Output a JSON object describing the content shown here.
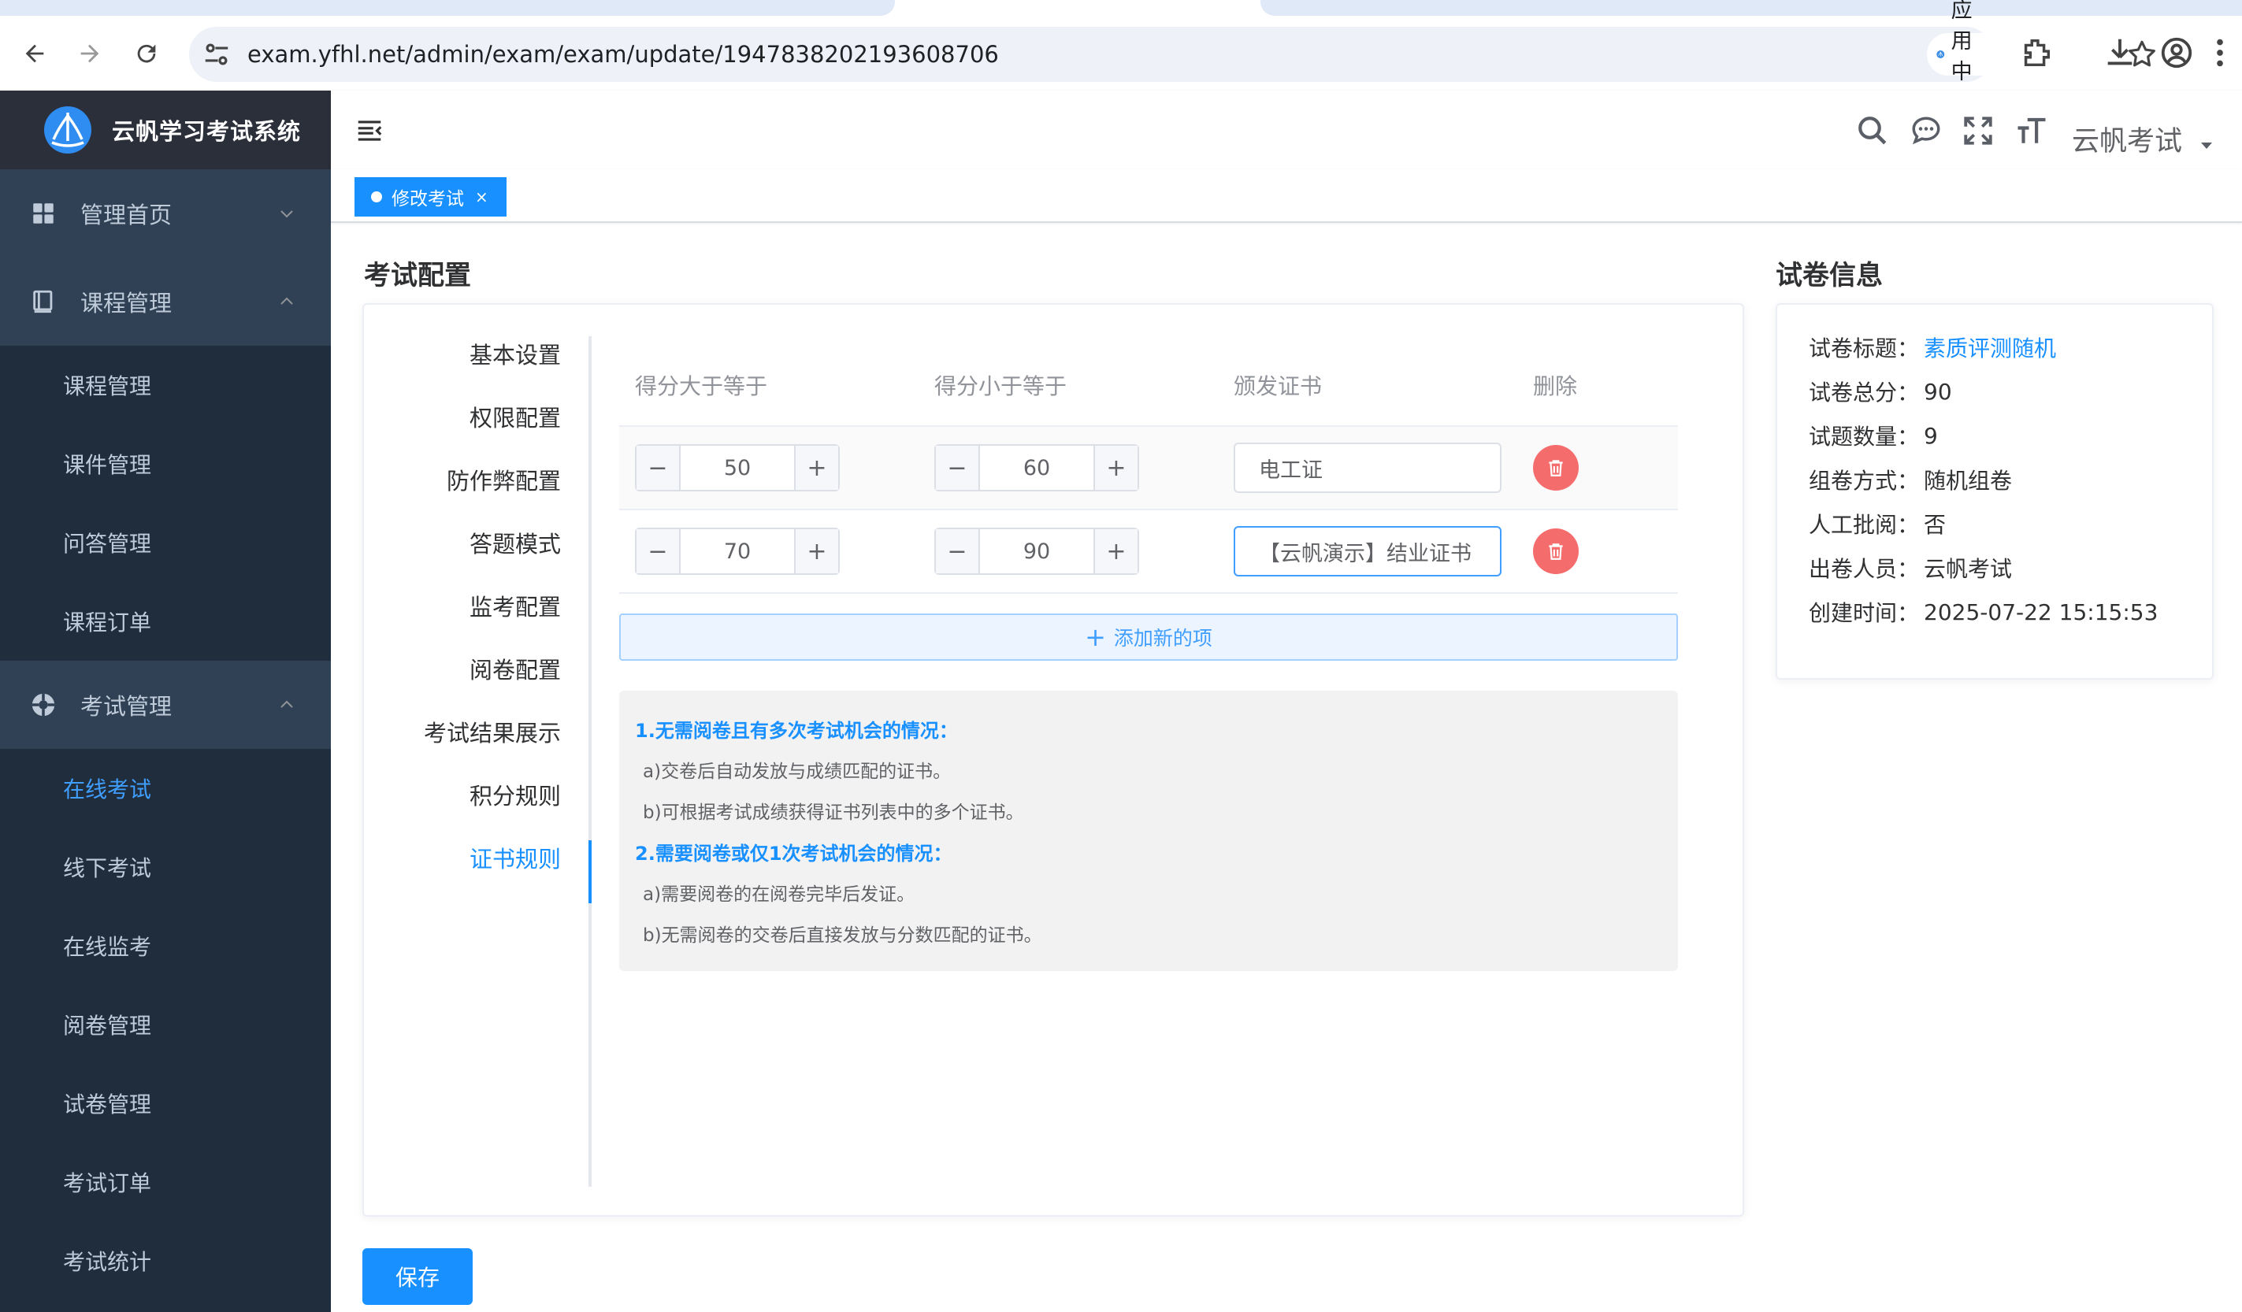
{
  "browser": {
    "url": "exam.yfhl.net/admin/exam/exam/update/1947838202193608706",
    "open_in_app": "在应用中打开"
  },
  "sidebar": {
    "brand_title": "云帆学习考试系统",
    "groups": [
      {
        "label": "管理首页",
        "icon": "dashboard-icon",
        "expanded": false,
        "items": []
      },
      {
        "label": "课程管理",
        "icon": "book-icon",
        "expanded": true,
        "items": [
          "课程管理",
          "课件管理",
          "问答管理",
          "课程订单"
        ]
      },
      {
        "label": "考试管理",
        "icon": "exam-icon",
        "expanded": true,
        "items": [
          "在线考试",
          "线下考试",
          "在线监考",
          "阅卷管理",
          "试卷管理",
          "考试订单",
          "考试统计"
        ],
        "active_item": "在线考试"
      }
    ]
  },
  "header": {
    "user": "云帆考试"
  },
  "tags": {
    "active_tag": "修改考试",
    "close": "×"
  },
  "main": {
    "title": "考试配置",
    "config_menu": [
      "基本设置",
      "权限配置",
      "防作弊配置",
      "答题模式",
      "监考配置",
      "阅卷配置",
      "考试结果展示",
      "积分规则",
      "证书规则"
    ],
    "active_menu": "证书规则",
    "table": {
      "headers": [
        "得分大于等于",
        "得分小于等于",
        "颁发证书",
        "删除"
      ],
      "rows": [
        {
          "min": "50",
          "max": "60",
          "cert": "电工证"
        },
        {
          "min": "70",
          "max": "90",
          "cert": "【云帆演示】结业证书"
        }
      ],
      "minus": "−",
      "plus": "+"
    },
    "add_button": "添加新的项",
    "tips": {
      "h1": "1.无需阅卷且有多次考试机会的情况：",
      "l1": "a)交卷后自动发放与成绩匹配的证书。",
      "l2": "b)可根据考试成绩获得证书列表中的多个证书。",
      "h2": "2.需要阅卷或仅1次考试机会的情况：",
      "l3": "a)需要阅卷的在阅卷完毕后发证。",
      "l4": "b)无需阅卷的交卷后直接发放与分数匹配的证书。"
    },
    "save": "保存"
  },
  "paper": {
    "title": "试卷信息",
    "rows": [
      {
        "k": "试卷标题：",
        "v": "素质评测随机"
      },
      {
        "k": "试卷总分：",
        "v": "90"
      },
      {
        "k": "试题数量：",
        "v": " 9"
      },
      {
        "k": "组卷方式：",
        "v": " 随机组卷"
      },
      {
        "k": "人工批阅：",
        "v": " 否"
      },
      {
        "k": "出卷人员：",
        "v": "云帆考试"
      },
      {
        "k": "创建时间：",
        "v": "2025-07-22 15:15:53"
      }
    ]
  },
  "colors": {
    "primary": "#1890ff",
    "sidebar_bg": "#1f2d3d",
    "danger": "#f56c6c"
  }
}
